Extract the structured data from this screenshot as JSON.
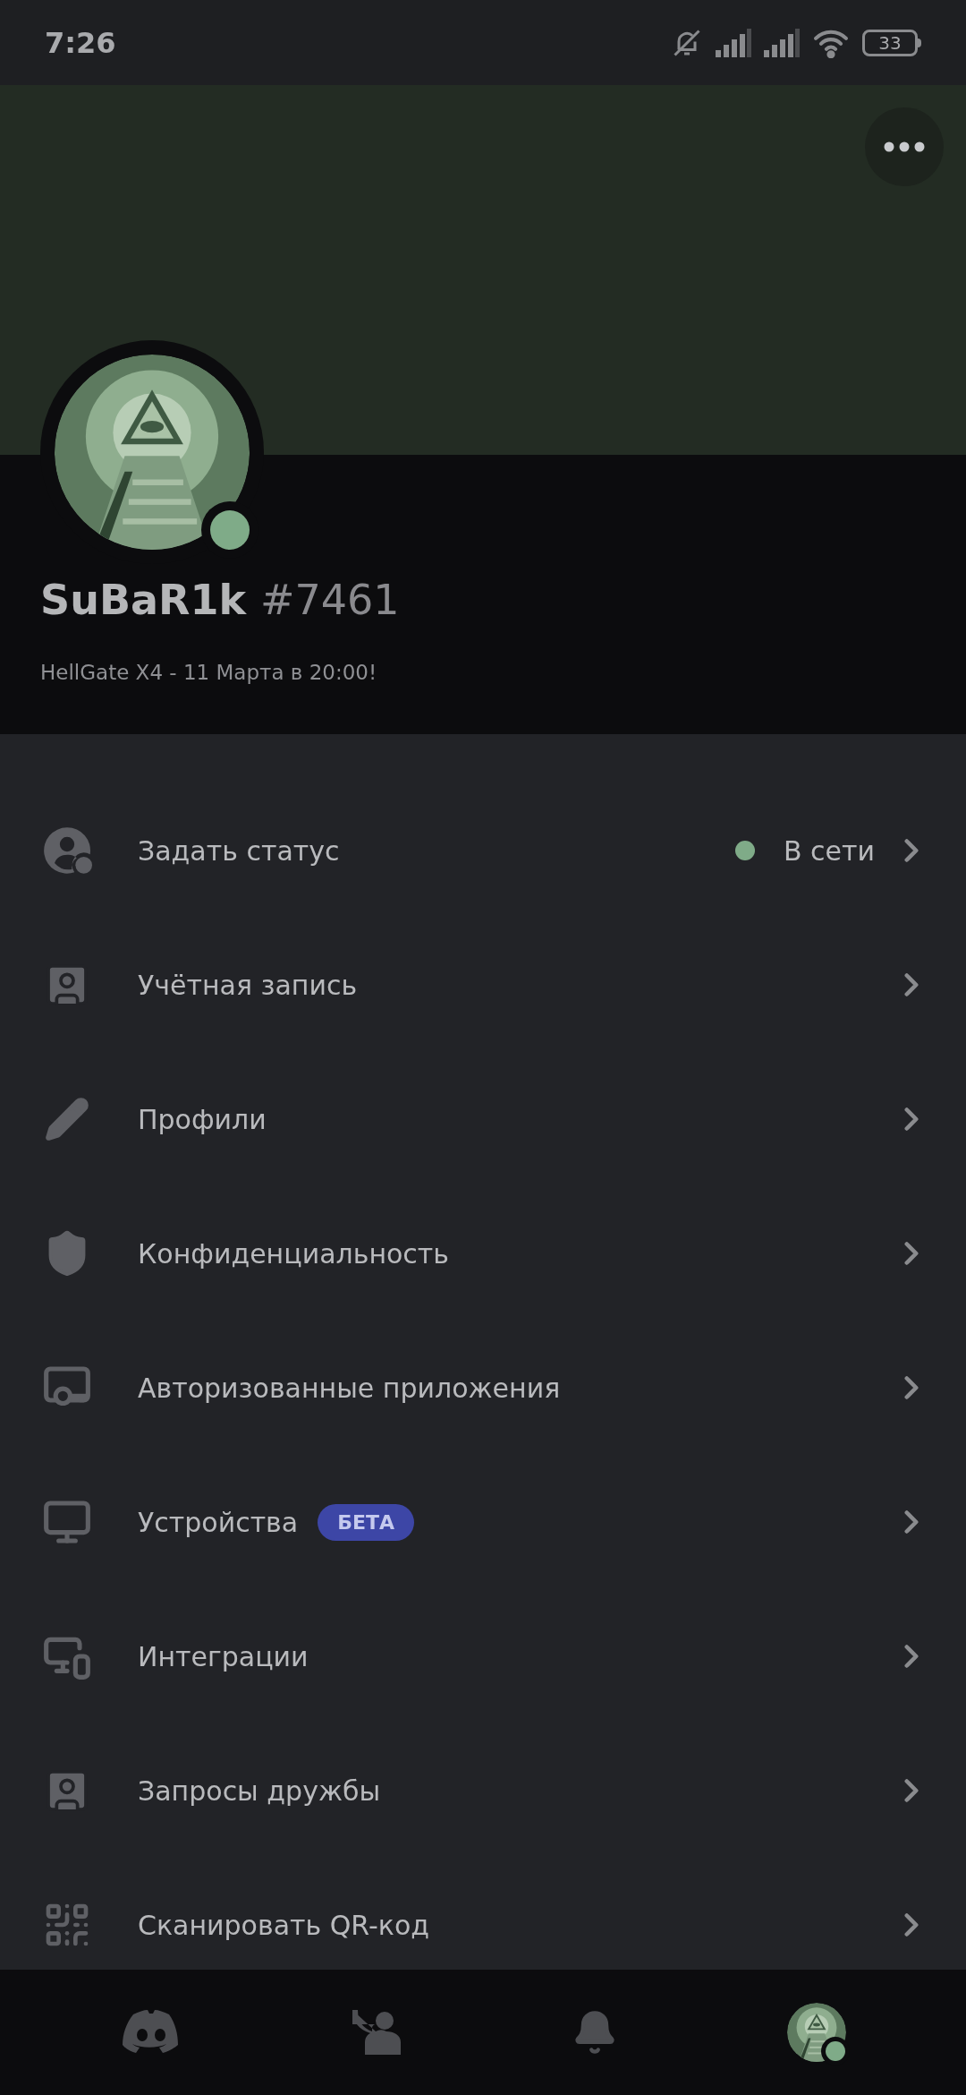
{
  "status_bar": {
    "time": "7:26",
    "battery": "33"
  },
  "profile": {
    "username": "SuBaR1k",
    "discriminator": "#7461",
    "bio": "HellGate X4 - 11 Марта в 20:00!",
    "online": true
  },
  "menu": [
    {
      "label": "Задать статус",
      "status": {
        "label": "В сети",
        "color": "#7fab88"
      }
    },
    {
      "label": "Учётная запись"
    },
    {
      "label": "Профили"
    },
    {
      "label": "Конфиденциальность"
    },
    {
      "label": "Авторизованные приложения"
    },
    {
      "label": "Устройства",
      "badge": "БЕТА"
    },
    {
      "label": "Интеграции"
    },
    {
      "label": "Запросы дружбы"
    },
    {
      "label": "Сканировать QR-код"
    }
  ]
}
